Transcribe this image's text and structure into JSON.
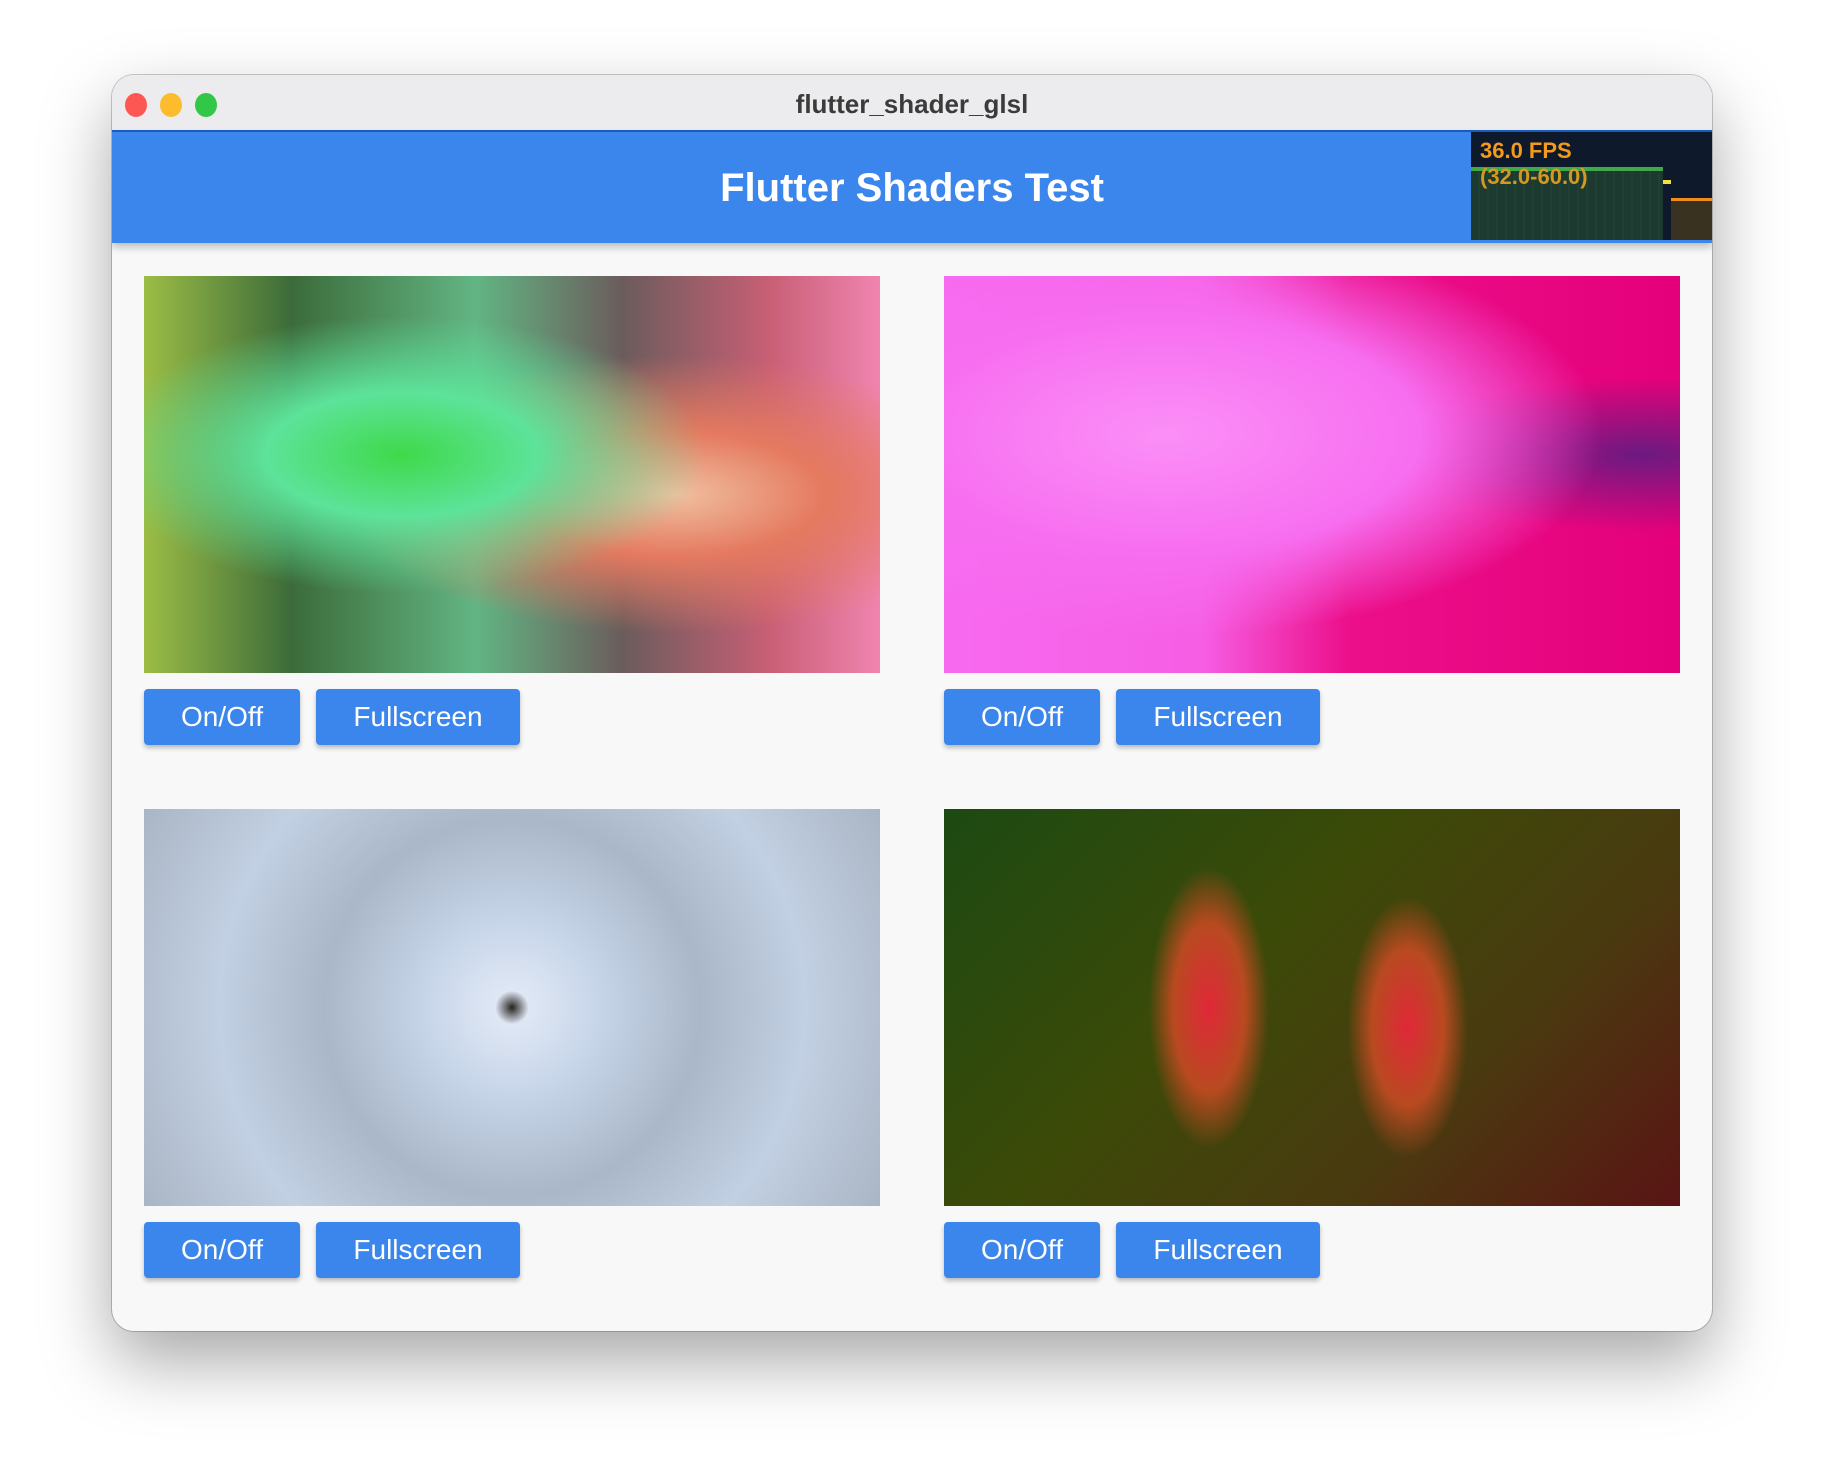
{
  "window": {
    "title": "flutter_shader_glsl"
  },
  "appbar": {
    "title": "Flutter Shaders Test"
  },
  "fps": {
    "current": "36.0 FPS",
    "range": "(32.0-60.0)"
  },
  "shaders": [
    {
      "onoff": "On/Off",
      "fullscreen": "Fullscreen"
    },
    {
      "onoff": "On/Off",
      "fullscreen": "Fullscreen"
    },
    {
      "onoff": "On/Off",
      "fullscreen": "Fullscreen"
    },
    {
      "onoff": "On/Off",
      "fullscreen": "Fullscreen"
    }
  ]
}
